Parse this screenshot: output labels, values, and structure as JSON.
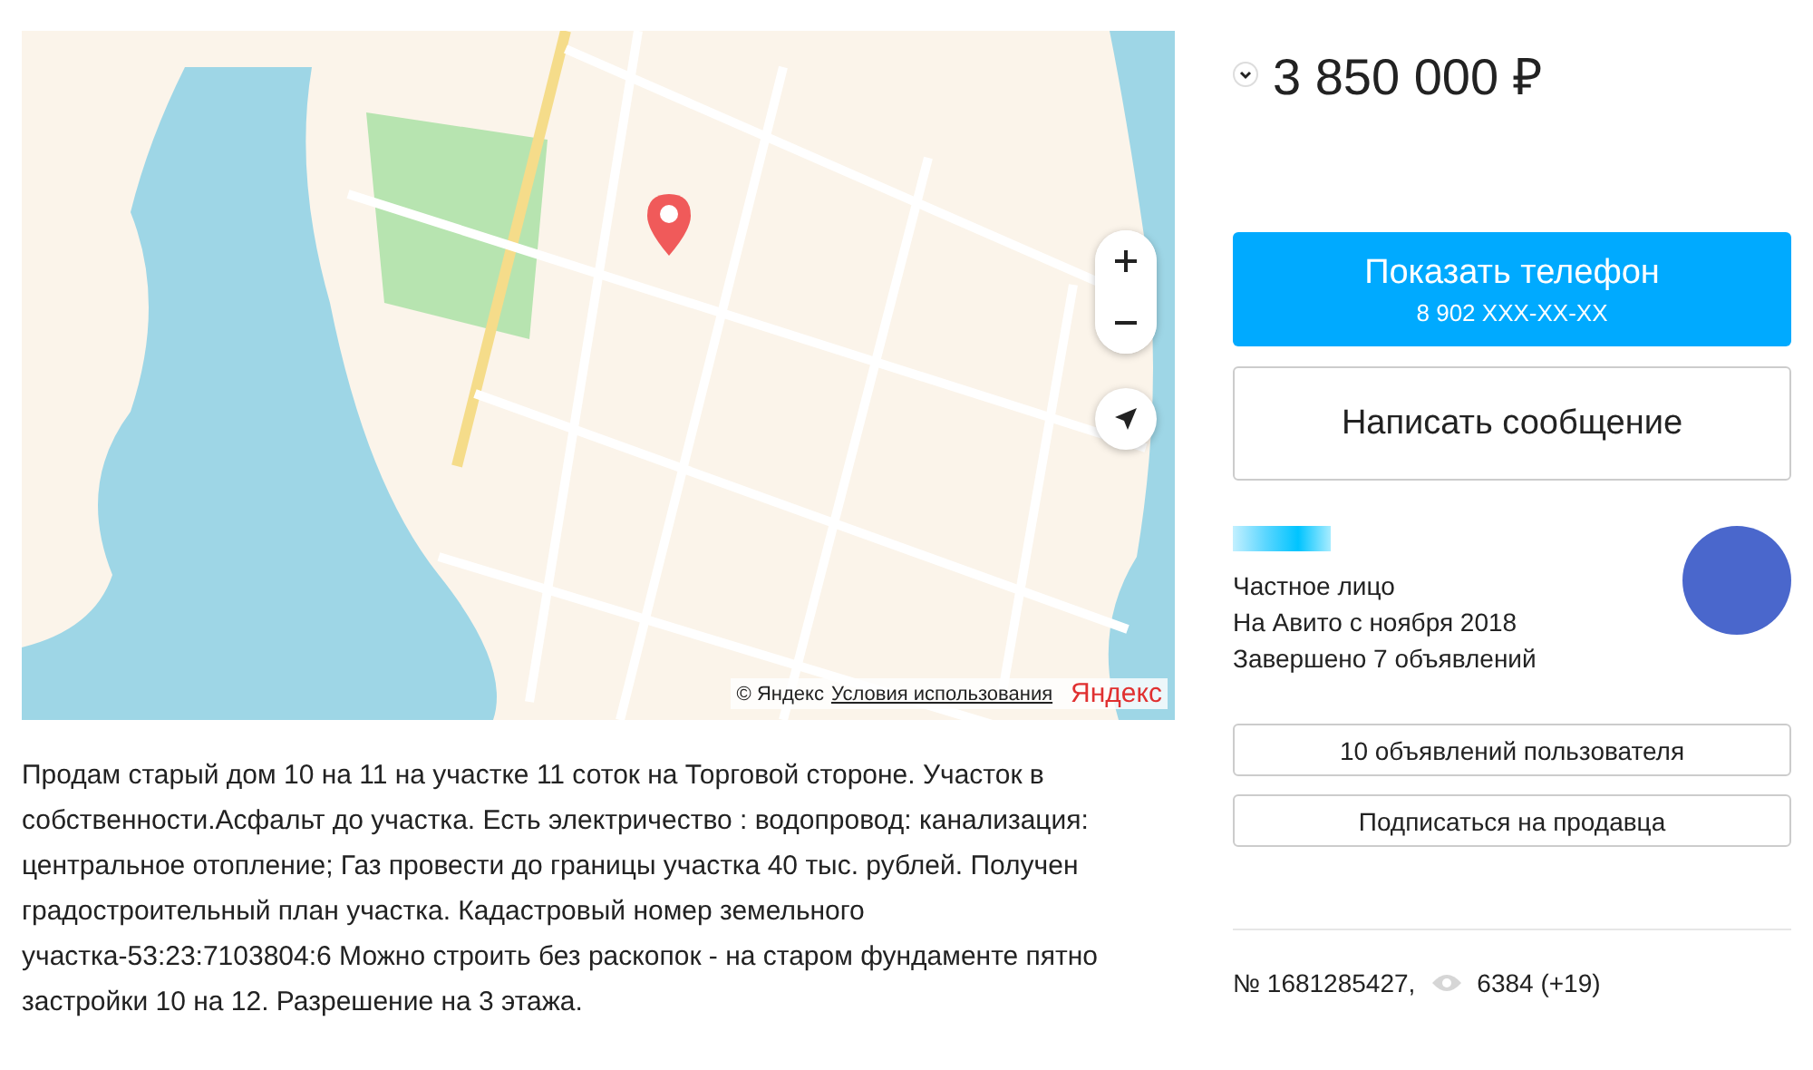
{
  "map": {
    "attribution": "© Яндекс",
    "terms_link": "Условия использования",
    "logo": "Яндекс"
  },
  "description": "Продам старый дом 10 на 11 на участке 11 соток на Торговой стороне. Участок в собственности.Асфальт до участка. Есть электричество : водопровод: канализация: центральное отопление; Газ провести до границы участка 40 тыс. рублей. Получен градостроительный план участка. Кадастровый номер земельного участка-53:23:7103804:6 Можно строить без раскопок - на старом фундаменте пятно застройки 10 на 12. Разрешение на 3 этажа.",
  "price": "3 850 000 ₽",
  "phone_button": {
    "label": "Показать телефон",
    "phone": "8 902 XXX-XX-XX"
  },
  "message_button": "Написать сообщение",
  "seller": {
    "type": "Частное лицо",
    "since": "На Авито с ноября 2018",
    "completed": "Завершено 7 объявлений"
  },
  "seller_buttons": [
    "10 объявлений пользователя",
    "Подписаться на продавца"
  ],
  "ad_number": "№ 1681285427,",
  "views": "6384 (+19)"
}
